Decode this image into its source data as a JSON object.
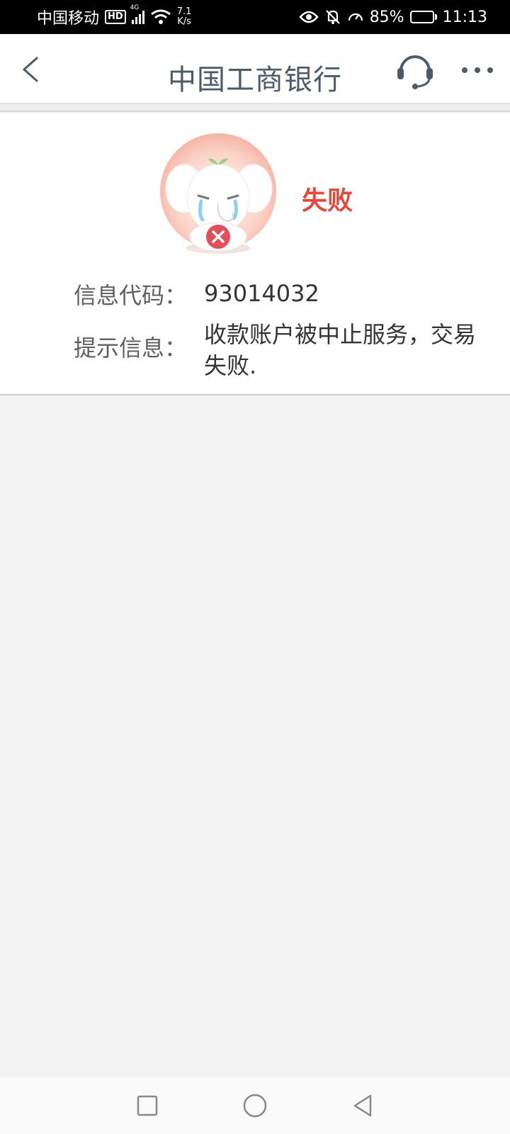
{
  "status_bar": {
    "carrier": "中国移动",
    "hd": "HD",
    "network_type": "4G",
    "net_speed_value": "7.1",
    "net_speed_unit": "K/s",
    "battery_percent": "85%",
    "battery_level": 0.85,
    "time": "11:13"
  },
  "header": {
    "title": "中国工商银行",
    "icons": [
      "back-icon",
      "headset-icon",
      "more-icon"
    ]
  },
  "result": {
    "status": "失败",
    "status_color": "#e04a3c",
    "code_label": "信息代码：",
    "code_value": "93014032",
    "message_label": "提示信息：",
    "message_value": "收款账户被中止服务，交易失败."
  },
  "nav_bar": {
    "icons": [
      "recent-apps-icon",
      "home-icon",
      "back-nav-icon"
    ]
  }
}
